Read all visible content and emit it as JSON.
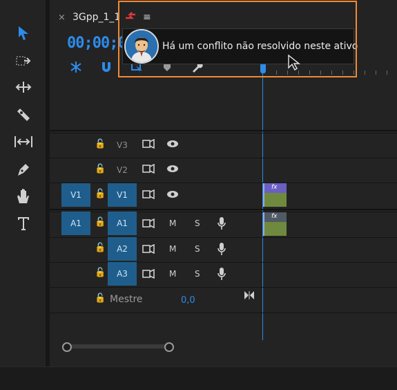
{
  "sequence": {
    "tab_title": "3Gpp_1_1",
    "close_glyph": "×",
    "menu_glyph": "≡",
    "timecode": "00;00;0"
  },
  "tooltip": {
    "text": "Há um conflito não resolvido neste ativo",
    "avatar_icon": "user-avatar-icon",
    "conflict_icon": "conflict-arrows-icon"
  },
  "tools": [
    {
      "name": "selection-tool",
      "glyph": "➤",
      "active": true
    },
    {
      "name": "track-select-tool",
      "glyph": "⇢"
    },
    {
      "name": "ripple-edit-tool",
      "glyph": "✥"
    },
    {
      "name": "razor-tool",
      "glyph": "◆"
    },
    {
      "name": "slip-tool",
      "glyph": "↔"
    },
    {
      "name": "pen-tool",
      "glyph": "✒"
    },
    {
      "name": "hand-tool",
      "glyph": "✋"
    },
    {
      "name": "type-tool",
      "glyph": "T"
    }
  ],
  "tracks": {
    "video": [
      {
        "src": "",
        "label": "V3",
        "lock": "🔓",
        "eye": "👁"
      },
      {
        "src": "",
        "label": "V2",
        "lock": "🔓",
        "eye": "👁"
      },
      {
        "src": "V1",
        "label": "V1",
        "lock": "🔓",
        "eye": "👁"
      }
    ],
    "audio": [
      {
        "src": "A1",
        "label": "A1",
        "m": "M",
        "s": "S"
      },
      {
        "src": "",
        "label": "A2",
        "m": "M",
        "s": "S"
      },
      {
        "src": "",
        "label": "A3",
        "m": "M",
        "s": "S"
      }
    ],
    "master": {
      "label": "Mestre",
      "value": "0,0"
    }
  },
  "clip": {
    "fx_label": "fx"
  },
  "colors": {
    "accent": "#2d8ceb",
    "highlight": "#f08a38",
    "track_target": "#1f5e8c"
  }
}
